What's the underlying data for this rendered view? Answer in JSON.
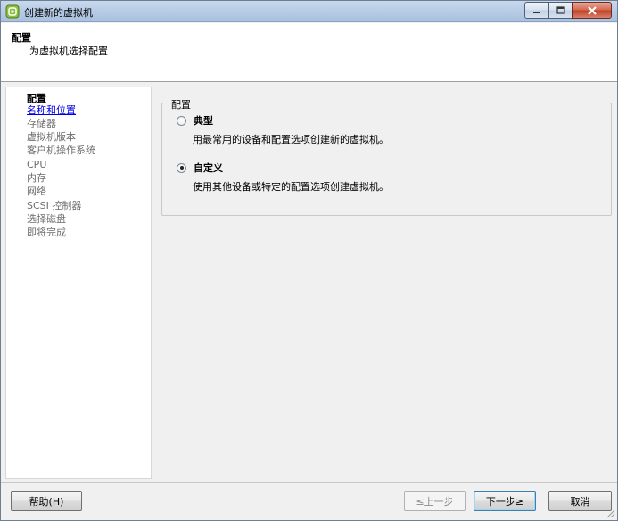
{
  "window": {
    "title": "创建新的虚拟机",
    "controls": {
      "minimize": "minimize-icon",
      "maximize": "maximize-icon",
      "close": "close-icon"
    }
  },
  "header": {
    "title": "配置",
    "subtitle": "为虚拟机选择配置"
  },
  "sidebar": {
    "items": [
      {
        "label": "配置",
        "state": "current"
      },
      {
        "label": "名称和位置",
        "state": "link"
      },
      {
        "label": "存储器",
        "state": "disabled"
      },
      {
        "label": "虚拟机版本",
        "state": "disabled"
      },
      {
        "label": "客户机操作系统",
        "state": "disabled"
      },
      {
        "label": "CPU",
        "state": "disabled"
      },
      {
        "label": "内存",
        "state": "disabled"
      },
      {
        "label": "网络",
        "state": "disabled"
      },
      {
        "label": "SCSI 控制器",
        "state": "disabled"
      },
      {
        "label": "选择磁盘",
        "state": "disabled"
      },
      {
        "label": "即将完成",
        "state": "disabled"
      }
    ]
  },
  "config_group": {
    "legend": "配置",
    "options": [
      {
        "label": "典型",
        "description": "用最常用的设备和配置选项创建新的虚拟机。",
        "checked": false
      },
      {
        "label": "自定义",
        "description": "使用其他设备或特定的配置选项创建虚拟机。",
        "checked": true
      }
    ]
  },
  "footer": {
    "help": "帮助(H)",
    "back": "≤上一步",
    "next": "下一步≥",
    "cancel": "取消"
  },
  "colors": {
    "link": "#0000e8",
    "disabled_text": "#6d6d6d",
    "titlebar": "#b8cde6",
    "close_button": "#c4432a"
  }
}
